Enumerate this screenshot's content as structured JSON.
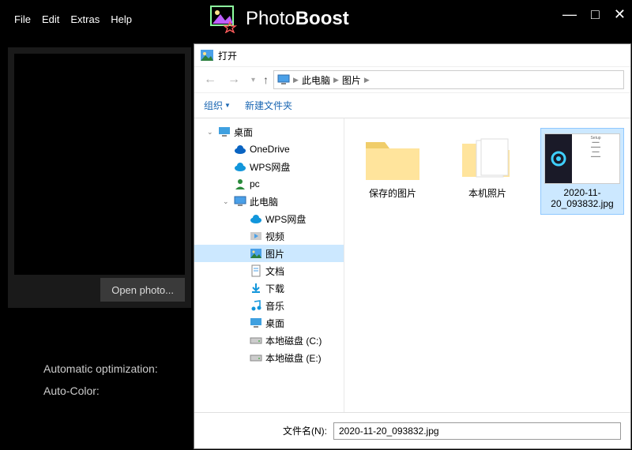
{
  "app": {
    "menubar": [
      "File",
      "Edit",
      "Extras",
      "Help"
    ],
    "title_light": "Photo",
    "title_bold": "Boost",
    "open_button": "Open photo...",
    "options": {
      "auto_opt": "Automatic optimization:",
      "auto_color": "Auto-Color:"
    }
  },
  "dialog": {
    "title": "打开",
    "breadcrumb": [
      "此电脑",
      "图片"
    ],
    "toolbar": {
      "organize": "组织",
      "new_folder": "新建文件夹"
    },
    "tree": [
      {
        "label": "桌面",
        "icon": "desktop",
        "level": 1,
        "expand": "open"
      },
      {
        "label": "OneDrive",
        "icon": "cloud-blue",
        "level": 2
      },
      {
        "label": "WPS网盘",
        "icon": "cloud-blue2",
        "level": 2
      },
      {
        "label": "pc",
        "icon": "user",
        "level": 2
      },
      {
        "label": "此电脑",
        "icon": "pc",
        "level": 2,
        "expand": "open"
      },
      {
        "label": "WPS网盘",
        "icon": "cloud-blue2",
        "level": 3
      },
      {
        "label": "视频",
        "icon": "video",
        "level": 3
      },
      {
        "label": "图片",
        "icon": "pictures",
        "level": 3,
        "selected": true
      },
      {
        "label": "文档",
        "icon": "docs",
        "level": 3
      },
      {
        "label": "下载",
        "icon": "downloads",
        "level": 3
      },
      {
        "label": "音乐",
        "icon": "music",
        "level": 3
      },
      {
        "label": "桌面",
        "icon": "desktop",
        "level": 3
      },
      {
        "label": "本地磁盘 (C:)",
        "icon": "drive",
        "level": 3
      },
      {
        "label": "本地磁盘 (E:)",
        "icon": "drive",
        "level": 3
      }
    ],
    "items": [
      {
        "name": "保存的图片",
        "type": "folder"
      },
      {
        "name": "本机照片",
        "type": "folder-open"
      },
      {
        "name": "2020-11-20_093832.jpg",
        "type": "image",
        "selected": true
      }
    ],
    "filename_label": "文件名(N):",
    "filename_value": "2020-11-20_093832.jpg"
  }
}
